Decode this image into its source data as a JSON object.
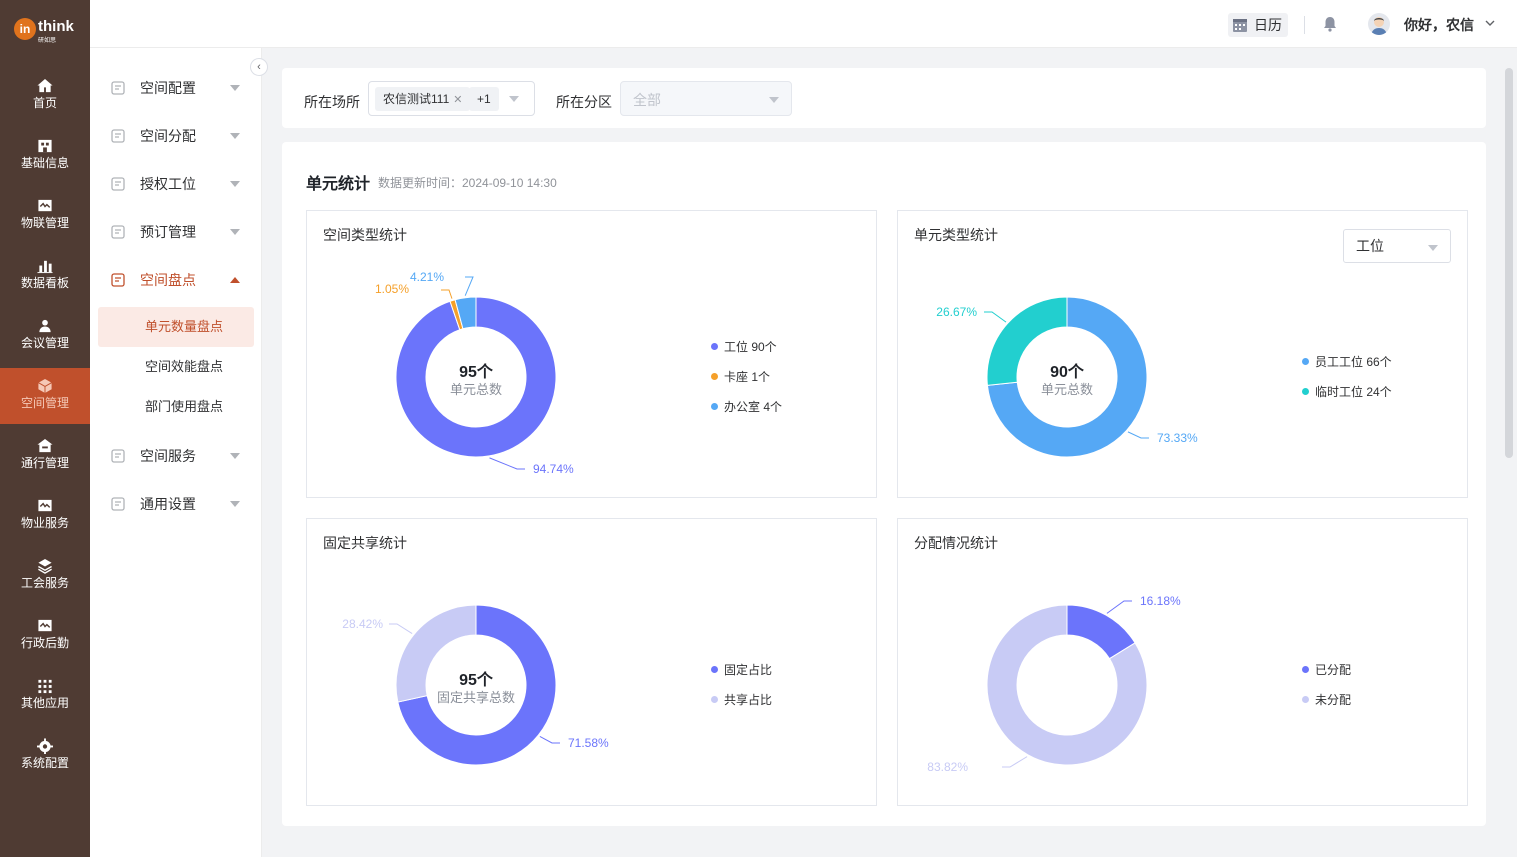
{
  "brand": {
    "name": "think",
    "mark": "in",
    "subtitle": "研如思"
  },
  "rail": [
    {
      "label": "首页",
      "icon": "home-icon"
    },
    {
      "label": "基础信息",
      "icon": "building-icon"
    },
    {
      "label": "物联管理",
      "icon": "iot-icon"
    },
    {
      "label": "数据看板",
      "icon": "chart-icon"
    },
    {
      "label": "会议管理",
      "icon": "meeting-icon"
    },
    {
      "label": "空间管理",
      "icon": "cube-icon",
      "active": true
    },
    {
      "label": "通行管理",
      "icon": "access-icon"
    },
    {
      "label": "物业服务",
      "icon": "property-icon"
    },
    {
      "label": "工会服务",
      "icon": "union-icon"
    },
    {
      "label": "行政后勤",
      "icon": "admin-icon"
    },
    {
      "label": "其他应用",
      "icon": "apps-grid-icon"
    },
    {
      "label": "系统配置",
      "icon": "gear-icon"
    }
  ],
  "menu": {
    "items": [
      {
        "label": "空间配置"
      },
      {
        "label": "空间分配"
      },
      {
        "label": "授权工位"
      },
      {
        "label": "预订管理"
      },
      {
        "label": "空间盘点",
        "open": true
      },
      {
        "label": "空间服务"
      },
      {
        "label": "通用设置"
      }
    ],
    "sub": [
      {
        "label": "单元数量盘点",
        "active": true
      },
      {
        "label": "空间效能盘点"
      },
      {
        "label": "部门使用盘点"
      }
    ]
  },
  "topbar": {
    "calendar": "日历",
    "greeting": "你好，农信"
  },
  "filter": {
    "place_label": "所在场所",
    "place_tag": "农信测试111",
    "place_more": "+1",
    "zone_label": "所在分区",
    "zone_placeholder": "全部"
  },
  "main": {
    "title": "单元统计",
    "updated": "数据更新时间：2024-09-10 14:30"
  },
  "panels": {
    "p1": {
      "title": "空间类型统计",
      "center_big": "95个",
      "center_small": "单元总数",
      "legend": [
        "工位 90个",
        "卡座 1个",
        "办公室 4个"
      ],
      "labels": [
        "94.74%",
        "1.05%",
        "4.21%"
      ]
    },
    "p2": {
      "title": "单元类型统计",
      "select": "工位",
      "center_big": "90个",
      "center_small": "单元总数",
      "legend": [
        "员工工位 66个",
        "临时工位 24个"
      ],
      "labels": [
        "73.33%",
        "26.67%"
      ]
    },
    "p3": {
      "title": "固定共享统计",
      "center_big": "95个",
      "center_small": "固定共享总数",
      "legend": [
        "固定占比",
        "共享占比"
      ],
      "labels": [
        "71.58%",
        "28.42%"
      ]
    },
    "p4": {
      "title": "分配情况统计",
      "legend": [
        "已分配",
        "未分配"
      ],
      "labels": [
        "16.18%",
        "83.82%"
      ]
    }
  },
  "colors": {
    "rail_bg": "#4f3b33",
    "accent": "#c0502c",
    "blue_dark": "#6b74fb",
    "orange": "#f5a02a",
    "blue_light": "#55a8f5",
    "teal": "#22cfcf",
    "lavender": "#c8cbf5"
  },
  "chart_data": [
    {
      "type": "pie",
      "title": "空间类型统计",
      "categories": [
        "工位",
        "卡座",
        "办公室"
      ],
      "values": [
        90,
        1,
        4
      ],
      "percent": [
        94.74,
        1.05,
        4.21
      ],
      "colors": [
        "#6b74fb",
        "#f5a02a",
        "#55a8f5"
      ]
    },
    {
      "type": "pie",
      "title": "单元类型统计",
      "categories": [
        "员工工位",
        "临时工位"
      ],
      "values": [
        66,
        24
      ],
      "percent": [
        73.33,
        26.67
      ],
      "colors": [
        "#55a8f5",
        "#22cfcf"
      ]
    },
    {
      "type": "pie",
      "title": "固定共享统计",
      "categories": [
        "固定占比",
        "共享占比"
      ],
      "percent": [
        71.58,
        28.42
      ],
      "colors": [
        "#6b74fb",
        "#c8cbf5"
      ]
    },
    {
      "type": "pie",
      "title": "分配情况统计",
      "categories": [
        "已分配",
        "未分配"
      ],
      "percent": [
        16.18,
        83.82
      ],
      "colors": [
        "#6b74fb",
        "#c8cbf5"
      ]
    }
  ]
}
